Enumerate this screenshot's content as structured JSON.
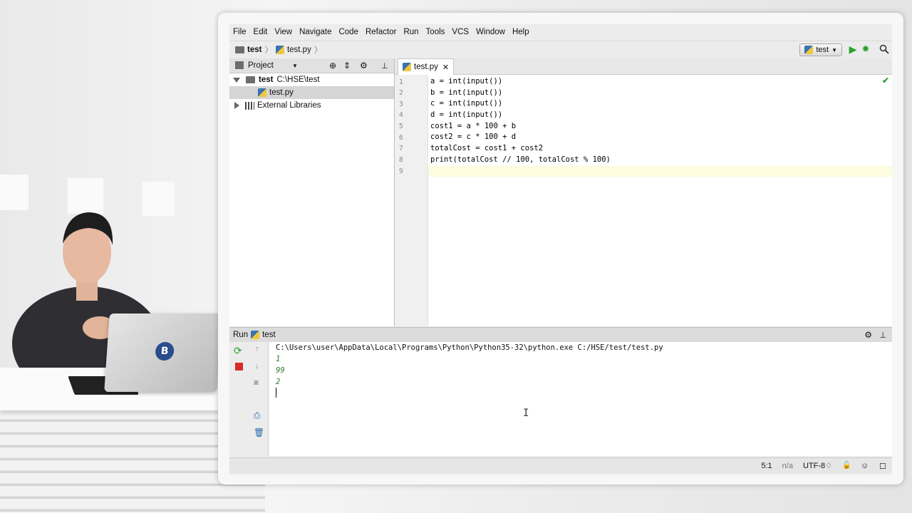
{
  "menu": [
    "File",
    "Edit",
    "View",
    "Navigate",
    "Code",
    "Refactor",
    "Run",
    "Tools",
    "VCS",
    "Window",
    "Help"
  ],
  "breadcrumb": {
    "project": "test",
    "file": "test.py"
  },
  "run_config": {
    "label": "test"
  },
  "project_panel": {
    "header": "Project",
    "tree": [
      {
        "name": "test",
        "path": "C:\\HSE\\test"
      },
      {
        "name": "test.py"
      },
      {
        "name": "External Libraries"
      }
    ]
  },
  "editor": {
    "tab": "test.py",
    "line_numbers": [
      "1",
      "2",
      "3",
      "4",
      "5",
      "6",
      "7",
      "8",
      "9"
    ],
    "lines": [
      "a = int(input())",
      "b = int(input())",
      "c = int(input())",
      "d = int(input())",
      "cost1 = a * 100 + b",
      "cost2 = c * 100 + d",
      "totalCost = cost1 + cost2",
      "print(totalCost // 100, totalCost % 100)",
      ""
    ]
  },
  "run_panel": {
    "title": "Run",
    "config": "test",
    "command": "C:\\Users\\user\\AppData\\Local\\Programs\\Python\\Python35-32\\python.exe C:/HSE/test/test.py",
    "output": [
      "1",
      "99",
      "2"
    ]
  },
  "status": {
    "position": "5:1",
    "separator": "n/a",
    "encoding": "UTF-8♢"
  },
  "colors": {
    "run_green": "#2fa12f",
    "stop_red": "#d42c2c",
    "py_blue": "#3a72b0",
    "py_yellow": "#f0c73a"
  }
}
